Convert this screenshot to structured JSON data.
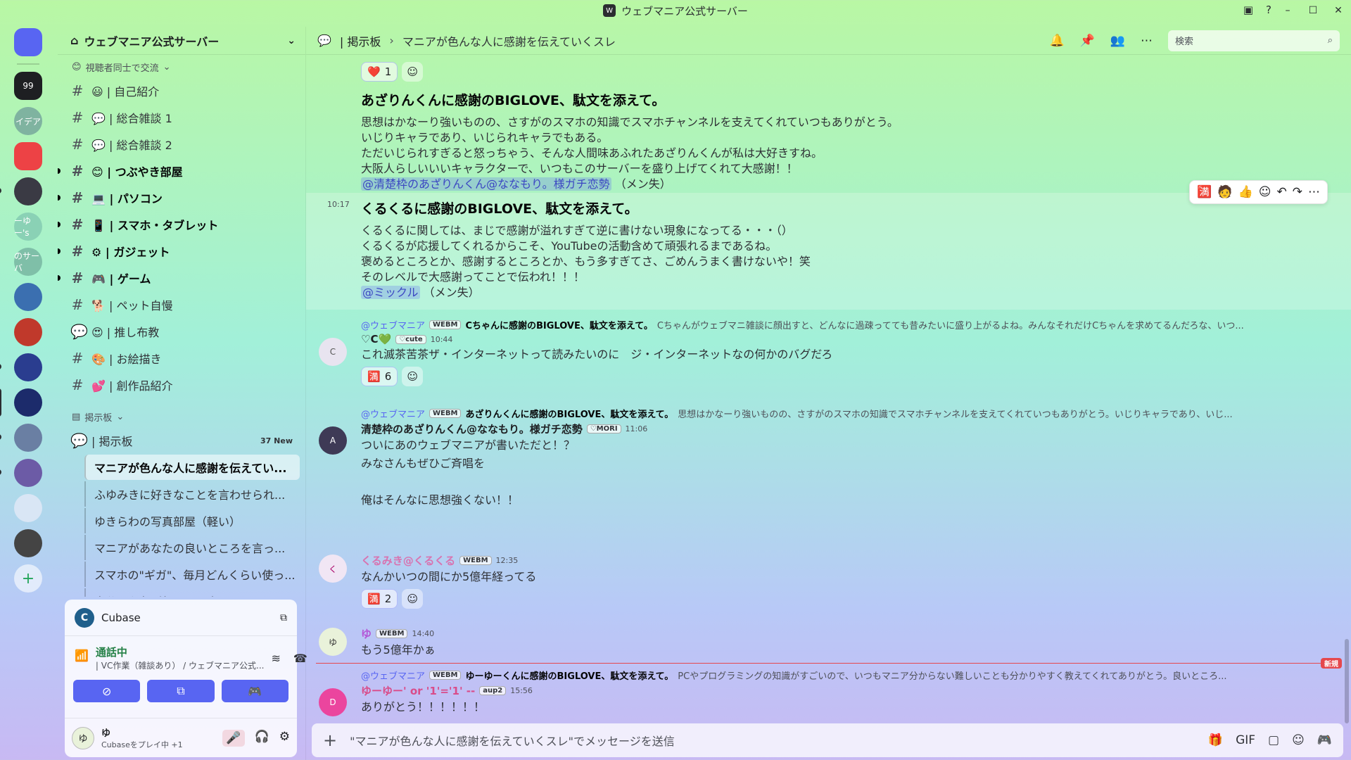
{
  "window": {
    "title": "ウェブマニア公式サーバー"
  },
  "rail": {
    "servers": [
      {
        "label": "",
        "color": "#5865f2",
        "square": true,
        "pip": false
      },
      {
        "label": "99",
        "color": "#1e1f22",
        "square": true,
        "pip": false
      },
      {
        "label": "イデア",
        "color": "#7fb3a0",
        "square": false,
        "pip": false
      },
      {
        "label": "",
        "color": "#ed4245",
        "square": true,
        "pip": false
      },
      {
        "label": "",
        "color": "#3a3a44",
        "square": false,
        "pip": true
      },
      {
        "label": "ーゆー's",
        "color": "#8ad1b5",
        "square": false,
        "pip": false
      },
      {
        "label": "のサーバ",
        "color": "#7fbfa8",
        "square": false,
        "pip": false
      },
      {
        "label": "",
        "color": "#3b6fb0",
        "square": false,
        "pip": false
      },
      {
        "label": "",
        "color": "#c0392b",
        "square": false,
        "pip": false
      },
      {
        "label": "",
        "color": "#2a3d8f",
        "square": false,
        "pip": true
      },
      {
        "label": "",
        "color": "#1c2b6b",
        "square": false,
        "pip": true,
        "selected": true
      },
      {
        "label": "",
        "color": "#6a7fa3",
        "square": false,
        "pip": true
      },
      {
        "label": "",
        "color": "#6c5ba6",
        "square": false,
        "pip": true
      },
      {
        "label": "",
        "color": "#d9e6f5",
        "square": false,
        "pip": false
      },
      {
        "label": "",
        "color": "#444",
        "square": false,
        "pip": false
      }
    ],
    "add_label": "+"
  },
  "sidebar": {
    "server_name": "ウェブマニア公式サーバー",
    "category_top": "視聴者同士で交流",
    "channels": [
      {
        "icon": "#",
        "name": "😃 | 自己紹介",
        "unread": false
      },
      {
        "icon": "#",
        "name": "💬 | 総合雑談 1",
        "unread": false
      },
      {
        "icon": "#",
        "name": "💬 | 総合雑談 2",
        "unread": false
      },
      {
        "icon": "#",
        "name": "😊 | つぶやき部屋",
        "unread": true
      },
      {
        "icon": "#",
        "name": "💻 | パソコン",
        "unread": true
      },
      {
        "icon": "#",
        "name": "📱 | スマホ・タブレット",
        "unread": true
      },
      {
        "icon": "#",
        "name": "⚙ | ガジェット",
        "unread": true
      },
      {
        "icon": "#",
        "name": "🎮 | ゲーム",
        "unread": true
      },
      {
        "icon": "#",
        "name": "🐕 | ペット自慢",
        "unread": false
      },
      {
        "icon": "💬",
        "name": "😍 | 推し布教",
        "unread": false
      },
      {
        "icon": "#",
        "name": "🎨 | お絵描き",
        "unread": false
      },
      {
        "icon": "#",
        "name": "💕 | 創作品紹介",
        "unread": false
      }
    ],
    "category_board": "掲示板",
    "board_channel": {
      "icon": "💬",
      "name": "| 掲示板",
      "badge": "37 New"
    },
    "threads": [
      {
        "name": "マニアが色んな人に感謝を伝えてい...",
        "active": true
      },
      {
        "name": "ふゆみきに好きなことを言わせられ...",
        "active": false
      },
      {
        "name": "ゆきらわの写真部屋（軽い）",
        "active": false
      },
      {
        "name": "マニアがあなたの良いところを言っ...",
        "active": false
      },
      {
        "name": "スマホの\"ギガ\"、毎月どんくらい使っ...",
        "active": false
      },
      {
        "name": "自分の印象が気になる人スレ",
        "active": false
      }
    ]
  },
  "panel": {
    "activity_app": "Cubase",
    "voice_status": "通話中",
    "voice_channel": "| VC作業（雑談あり） / ウェブマニア公式...",
    "user_name": "ゆ",
    "user_status": "Cubaseをプレイ中 +1"
  },
  "topbar": {
    "board": "| 掲示板",
    "thread_title": "マニアが色んな人に感謝を伝えていくスレ",
    "search_placeholder": "検索"
  },
  "messages": {
    "reaction_top": {
      "emoji": "❤️",
      "count": "1"
    },
    "m1": {
      "head": "あざりんくんに感謝のBIGLOVE、駄文を添えて。",
      "lines": [
        "思想はかなーり強いものの、さすがのスマホの知識でスマホチャンネルを支えてくれていつもありがとう。",
        "いじりキャラであり、いじられキャラでもある。",
        "ただいじられすぎると怒っちゃう、そんな人間味あふれたあざりんくんが私は大好きすね。",
        "大阪人らしいいいキャラクターで、いつもこのサーバーを盛り上げてくれて大感謝！！"
      ],
      "mention": "@清楚枠のあざりんくん@ななもり。様ガチ恋勢",
      "suffix": "（メン失）"
    },
    "m2": {
      "time": "10:17",
      "head": "くるくるに感謝のBIGLOVE、駄文を添えて。",
      "lines": [
        "くるくるに関しては、まじで感謝が溢れすぎて逆に書けない現象になってる・・・（）",
        "くるくるが応援してくれるからこそ、YouTubeの活動含めて頑張れるまであるね。",
        "褒めるところとか、感謝するところとか、もう多すぎてさ、ごめんうまく書けないや！笑",
        "そのレベルで大感謝ってことで伝われ！！！"
      ],
      "mention": "@ミックル",
      "suffix": "（メン失）"
    },
    "m3": {
      "reply_name": "@ウェブマニア",
      "reply_tag": "WEBM",
      "reply_bold": "Cちゃんに感謝のBIGLOVE、駄文を添えて。",
      "reply_text": "Cちゃんがウェブマニ雑談に顔出すと、どんなに過疎ってても昔みたいに盛り上がるよね。みんなそれだけCちゃんを求めてるんだろな、いつ...",
      "author": "♡C💚",
      "tag": "♡cute",
      "time": "10:44",
      "body": "これ滅茶苦茶ザ・インターネットって読みたいのに　ジ・インターネットなの何かのバグだろ",
      "reaction": {
        "emoji": "🈵",
        "count": "6"
      }
    },
    "m4": {
      "reply_name": "@ウェブマニア",
      "reply_tag": "WEBM",
      "reply_bold": "あざりんくんに感謝のBIGLOVE、駄文を添えて。",
      "reply_text": "思想はかなーり強いものの、さすがのスマホの知識でスマホチャンネルを支えてくれていつもありがとう。いじりキャラであり、いじ...",
      "author": "清楚枠のあざりんくん@ななもり。様ガチ恋勢",
      "tag": "♡MORI",
      "time": "11:06",
      "lines": [
        "ついにあのウェブマニアが書いただと！？",
        "みなさんもぜひご斉唱を",
        "",
        "俺はそんなに思想強くない！！"
      ]
    },
    "m5": {
      "author": "くるみき@くるくる",
      "tag": "WEBM",
      "time": "12:35",
      "body": "なんかいつの間にか5億年経ってる",
      "reaction": {
        "emoji": "🈵",
        "count": "2"
      }
    },
    "m6": {
      "author": "ゆ",
      "tag": "WEBM",
      "time": "14:40",
      "body": "もう5億年かぁ"
    },
    "new_label": "新規",
    "m7": {
      "reply_name": "@ウェブマニア",
      "reply_tag": "WEBM",
      "reply_bold": "ゆーゆーくんに感謝のBIGLOVE、駄文を添えて。",
      "reply_text": "PCやプログラミングの知識がすごいので、いつもマニア分からない難しいことも分かりやすく教えてくれてありがとう。良いところ...",
      "author": "ゆーゆー' or '1'='1' --",
      "tag": "aup2",
      "time": "15:56",
      "body": "ありがとう！！！！！！"
    }
  },
  "composer": {
    "placeholder": "\"マニアが色んな人に感謝を伝えていくスレ\"でメッセージを送信"
  }
}
